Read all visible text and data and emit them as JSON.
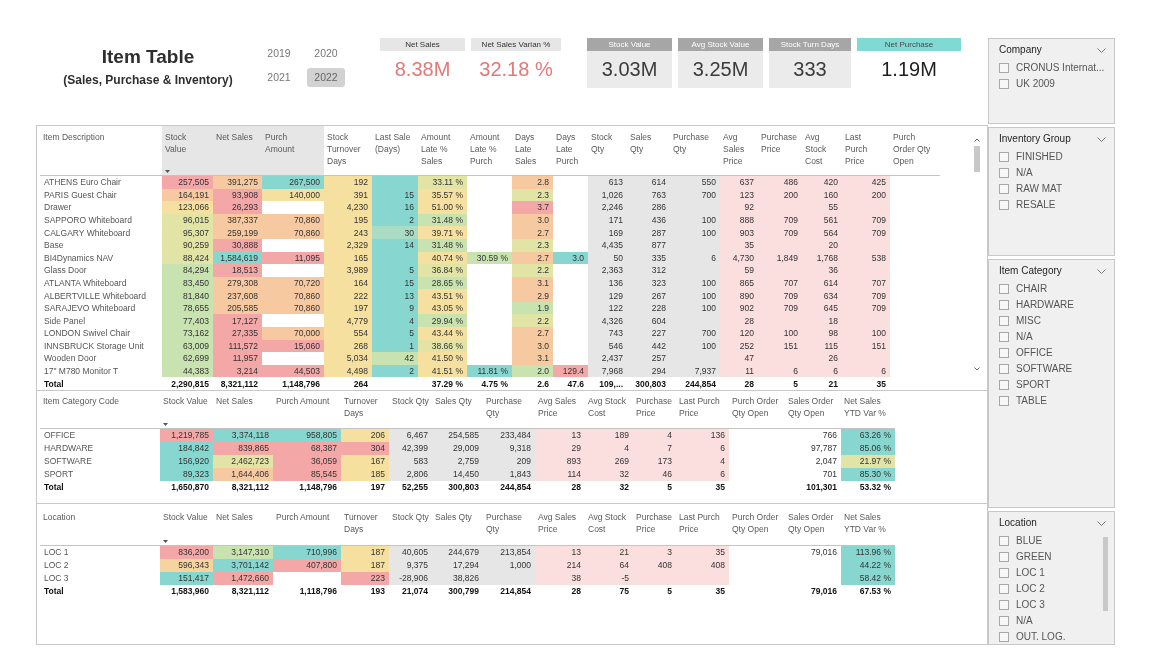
{
  "header": {
    "title": "Item Table",
    "subtitle": "(Sales, Purchase & Inventory)"
  },
  "years": [
    {
      "label": "2019",
      "selected": false
    },
    {
      "label": "2020",
      "selected": false
    },
    {
      "label": "2021",
      "selected": false
    },
    {
      "label": "2022",
      "selected": true
    }
  ],
  "cards": [
    {
      "kind": "sales",
      "label": "Net Sales",
      "value": "8.38M"
    },
    {
      "kind": "sales",
      "label": "Net Sales Varian %",
      "value": "32.18 %"
    },
    {
      "kind": "stock",
      "label": "Stock Value",
      "value": "3.03M"
    },
    {
      "kind": "stock",
      "label": "Avg Stock Value",
      "value": "3.25M"
    },
    {
      "kind": "stock",
      "label": "Stock Turn Days",
      "value": "333"
    },
    {
      "kind": "purchase",
      "label": "Net Purchase",
      "value": "1.19M"
    }
  ],
  "item_table": {
    "scrollable": true,
    "columns": [
      {
        "label": "Item Description",
        "sorted": false,
        "highlighted": false
      },
      {
        "label": "Stock Value",
        "sorted": true,
        "highlighted": true
      },
      {
        "label": "Net Sales",
        "sorted": false,
        "highlighted": true
      },
      {
        "label": "Purch Amount",
        "sorted": false,
        "highlighted": true
      },
      {
        "label": "Stock Turnover Days",
        "sorted": false,
        "highlighted": false
      },
      {
        "label": "Last Sale (Days)",
        "sorted": false,
        "highlighted": false
      },
      {
        "label": "Amount Late % Sales",
        "sorted": false,
        "highlighted": false
      },
      {
        "label": "Amount Late % Purch",
        "sorted": false,
        "highlighted": false
      },
      {
        "label": "Days Late Sales",
        "sorted": false,
        "highlighted": false
      },
      {
        "label": "Days Late Purch",
        "sorted": false,
        "highlighted": false
      },
      {
        "label": "Stock Qty",
        "sorted": false,
        "highlighted": false,
        "color": "#e6e6e6"
      },
      {
        "label": "Sales Qty",
        "sorted": false,
        "highlighted": false,
        "color": "#e6e6e6"
      },
      {
        "label": "Purchase Qty",
        "sorted": false,
        "highlighted": false,
        "color": "#e6e6e6"
      },
      {
        "label": "Avg Sales Price",
        "sorted": false,
        "highlighted": false,
        "color": "#fbdede"
      },
      {
        "label": "Purchase Price",
        "sorted": false,
        "highlighted": false,
        "color": "#fbdede"
      },
      {
        "label": "Avg Stock Cost",
        "sorted": false,
        "highlighted": false,
        "color": "#fbdede"
      },
      {
        "label": "Last Purch Price",
        "sorted": false,
        "highlighted": false,
        "color": "#fbdede"
      },
      {
        "label": "Purch Order Qty Open",
        "sorted": false,
        "highlighted": false
      }
    ],
    "rows": [
      [
        "ATHENS Euro Chair",
        {
          "text": "257,505",
          "color": "#f4a7a7"
        },
        {
          "text": "391,275",
          "color": "#f7c9a1"
        },
        {
          "text": "267,500",
          "color": "#87d7d0"
        },
        {
          "text": "192",
          "color": "#f6e09f"
        },
        {
          "color": "#87d7d0"
        },
        {
          "text": "33.11 %",
          "color": "#e1e4a5"
        },
        null,
        {
          "text": "2.8",
          "color": "#f7c9a1"
        },
        null,
        "613",
        "614",
        "550",
        "637",
        "486",
        "420",
        "425"
      ],
      [
        "PARIS Guest Chair",
        {
          "text": "164,191",
          "color": "#f7c9a1"
        },
        {
          "text": "93,908",
          "color": "#f4a7a7"
        },
        {
          "text": "140,000",
          "color": "#f6e09f"
        },
        {
          "text": "391",
          "color": "#f6e09f"
        },
        {
          "text": "15",
          "color": "#87d7d0"
        },
        {
          "text": "35.57 %",
          "color": "#f6e09f"
        },
        null,
        {
          "text": "2.3",
          "color": "#e1e4a5"
        },
        null,
        "1,026",
        "763",
        "700",
        "123",
        "200",
        "160",
        "200"
      ],
      [
        "Drawer",
        {
          "text": "123,066",
          "color": "#f6e09f"
        },
        {
          "text": "26,293",
          "color": "#f4a7a7"
        },
        null,
        {
          "text": "4,230",
          "color": "#f6e09f"
        },
        {
          "text": "16",
          "color": "#87d7d0"
        },
        {
          "text": "51.00 %",
          "color": "#f6e09f"
        },
        null,
        {
          "text": "3.7",
          "color": "#f4a7a7"
        },
        null,
        "2,246",
        "286",
        null,
        "92",
        null,
        "55",
        null
      ],
      [
        "SAPPORO Whiteboard",
        {
          "text": "96,015",
          "color": "#e1e4a5"
        },
        {
          "text": "387,337",
          "color": "#f7c9a1"
        },
        {
          "text": "70,860",
          "color": "#f7c9a1"
        },
        {
          "text": "195",
          "color": "#f6e09f"
        },
        {
          "text": "2",
          "color": "#87d7d0"
        },
        {
          "text": "31.48 %",
          "color": "#c8e2b0"
        },
        null,
        {
          "text": "3.0",
          "color": "#f7c9a1"
        },
        null,
        "171",
        "436",
        "100",
        "888",
        "709",
        "561",
        "709"
      ],
      [
        "CALGARY Whiteboard",
        {
          "text": "95,307",
          "color": "#e1e4a5"
        },
        {
          "text": "259,199",
          "color": "#f7c9a1"
        },
        {
          "text": "70,860",
          "color": "#f7c9a1"
        },
        {
          "text": "243",
          "color": "#f6e09f"
        },
        {
          "text": "30",
          "color": "#a9dcc3"
        },
        {
          "text": "39.71 %",
          "color": "#f6e09f"
        },
        null,
        {
          "text": "2.7",
          "color": "#f7c9a1"
        },
        null,
        "169",
        "287",
        "100",
        "903",
        "709",
        "564",
        "709"
      ],
      [
        "Base",
        {
          "text": "90,259",
          "color": "#e1e4a5"
        },
        {
          "text": "30,888",
          "color": "#f4a7a7"
        },
        null,
        {
          "text": "2,329",
          "color": "#f6e09f"
        },
        {
          "text": "14",
          "color": "#87d7d0"
        },
        {
          "text": "31.48 %",
          "color": "#c8e2b0"
        },
        null,
        {
          "text": "2.3",
          "color": "#e1e4a5"
        },
        null,
        "4,435",
        "877",
        null,
        "35",
        null,
        "20",
        null
      ],
      [
        "BI4Dynamics NAV",
        {
          "text": "88,424",
          "color": "#e1e4a5"
        },
        {
          "text": "1,584,619",
          "color": "#87d7d0"
        },
        {
          "text": "11,095",
          "color": "#f4a7a7"
        },
        {
          "text": "165",
          "color": "#f6e09f"
        },
        {
          "color": "#87d7d0"
        },
        {
          "text": "40.74 %",
          "color": "#f6e09f"
        },
        {
          "text": "30.59 %",
          "color": "#c8e2b0"
        },
        {
          "text": "2.7",
          "color": "#f7c9a1"
        },
        {
          "text": "3.0",
          "color": "#87d7d0"
        },
        "50",
        "335",
        "6",
        "4,730",
        "1,849",
        "1,768",
        "538"
      ],
      [
        "Glass Door",
        {
          "text": "84,294",
          "color": "#c8e2b0"
        },
        {
          "text": "18,513",
          "color": "#f4a7a7"
        },
        null,
        {
          "text": "3,989",
          "color": "#f6e09f"
        },
        {
          "text": "5",
          "color": "#87d7d0"
        },
        {
          "text": "36.84 %",
          "color": "#e1e4a5"
        },
        null,
        {
          "text": "2.2",
          "color": "#e1e4a5"
        },
        null,
        "2,363",
        "312",
        null,
        "59",
        null,
        "36",
        null
      ],
      [
        "ATLANTA Whiteboard",
        {
          "text": "83,450",
          "color": "#c8e2b0"
        },
        {
          "text": "279,308",
          "color": "#f7c9a1"
        },
        {
          "text": "70,720",
          "color": "#f7c9a1"
        },
        {
          "text": "164",
          "color": "#f6e09f"
        },
        {
          "text": "15",
          "color": "#87d7d0"
        },
        {
          "text": "28.65 %",
          "color": "#c8e2b0"
        },
        null,
        {
          "text": "3.1",
          "color": "#f7c9a1"
        },
        null,
        "136",
        "323",
        "100",
        "865",
        "707",
        "614",
        "707"
      ],
      [
        "ALBERTVILLE Whiteboard",
        {
          "text": "81,840",
          "color": "#c8e2b0"
        },
        {
          "text": "237,608",
          "color": "#f7c9a1"
        },
        {
          "text": "70,860",
          "color": "#f7c9a1"
        },
        {
          "text": "222",
          "color": "#f6e09f"
        },
        {
          "text": "13",
          "color": "#87d7d0"
        },
        {
          "text": "43.51 %",
          "color": "#f6e09f"
        },
        null,
        {
          "text": "2.9",
          "color": "#f7c9a1"
        },
        null,
        "129",
        "267",
        "100",
        "890",
        "709",
        "634",
        "709"
      ],
      [
        "SARAJEVO Whiteboard",
        {
          "text": "78,655",
          "color": "#c8e2b0"
        },
        {
          "text": "205,585",
          "color": "#f7c9a1"
        },
        {
          "text": "70,860",
          "color": "#f7c9a1"
        },
        {
          "text": "197",
          "color": "#f6e09f"
        },
        {
          "text": "9",
          "color": "#87d7d0"
        },
        {
          "text": "43.05 %",
          "color": "#f6e09f"
        },
        null,
        {
          "text": "1.9",
          "color": "#c8e2b0"
        },
        null,
        "122",
        "228",
        "100",
        "902",
        "709",
        "645",
        "709"
      ],
      [
        "Side Panel",
        {
          "text": "77,403",
          "color": "#c8e2b0"
        },
        {
          "text": "17,127",
          "color": "#f4a7a7"
        },
        null,
        {
          "text": "4,779",
          "color": "#f6e09f"
        },
        {
          "text": "4",
          "color": "#87d7d0"
        },
        {
          "text": "29.94 %",
          "color": "#c8e2b0"
        },
        null,
        {
          "text": "2.2",
          "color": "#e1e4a5"
        },
        null,
        "4,326",
        "604",
        null,
        "28",
        null,
        "18",
        null
      ],
      [
        "LONDON Swivel Chair",
        {
          "text": "73,162",
          "color": "#c8e2b0"
        },
        {
          "text": "27,335",
          "color": "#f4a7a7"
        },
        {
          "text": "70,000",
          "color": "#f7c9a1"
        },
        {
          "text": "554",
          "color": "#f6e09f"
        },
        {
          "text": "5",
          "color": "#87d7d0"
        },
        {
          "text": "43.44 %",
          "color": "#f6e09f"
        },
        null,
        {
          "text": "2.7",
          "color": "#f7c9a1"
        },
        null,
        "743",
        "227",
        "700",
        "120",
        "100",
        "98",
        "100"
      ],
      [
        "INNSBRUCK Storage Unit",
        {
          "text": "63,009",
          "color": "#c8e2b0"
        },
        {
          "text": "111,572",
          "color": "#f4a7a7"
        },
        {
          "text": "15,060",
          "color": "#f4a7a7"
        },
        {
          "text": "268",
          "color": "#f6e09f"
        },
        {
          "text": "1",
          "color": "#87d7d0"
        },
        {
          "text": "38.66 %",
          "color": "#e1e4a5"
        },
        null,
        {
          "text": "3.0",
          "color": "#f7c9a1"
        },
        null,
        "546",
        "442",
        "100",
        "252",
        "151",
        "115",
        "151"
      ],
      [
        "Wooden Door",
        {
          "text": "62,699",
          "color": "#c8e2b0"
        },
        {
          "text": "11,957",
          "color": "#f4a7a7"
        },
        null,
        {
          "text": "5,034",
          "color": "#f6e09f"
        },
        {
          "text": "42",
          "color": "#c8e2b0"
        },
        {
          "text": "41.50 %",
          "color": "#f6e09f"
        },
        null,
        {
          "text": "3.1",
          "color": "#f7c9a1"
        },
        null,
        "2,437",
        "257",
        null,
        "47",
        null,
        "26",
        null
      ],
      [
        "17\" M780 Monitor T",
        {
          "text": "44,383",
          "color": "#c8e2b0"
        },
        {
          "text": "3,214",
          "color": "#f4a7a7"
        },
        {
          "text": "44,503",
          "color": "#f4a7a7"
        },
        {
          "text": "4,498",
          "color": "#f6e09f"
        },
        {
          "text": "2",
          "color": "#87d7d0"
        },
        {
          "text": "41.51 %",
          "color": "#f6e09f"
        },
        {
          "text": "11.81 %",
          "color": "#87d7d0"
        },
        {
          "text": "2.0",
          "color": "#c8e2b0"
        },
        {
          "text": "129.4",
          "color": "#f4a7a7"
        },
        "7,968",
        "294",
        "7,937",
        "11",
        "6",
        "6",
        "6"
      ],
      [
        "Total",
        "2,290,815",
        "8,321,112",
        "1,148,796",
        "264",
        null,
        "37.29 %",
        "4.75 %",
        "2.6",
        "47.6",
        "109,...",
        "300,803",
        "244,854",
        "28",
        "5",
        "21",
        "35"
      ]
    ]
  },
  "category_table": {
    "columns": [
      {
        "label": "Item Category Code",
        "sorted": false
      },
      {
        "label": "Stock Value",
        "sorted": true
      },
      {
        "label": "Net Sales",
        "sorted": false
      },
      {
        "label": "Purch Amount",
        "sorted": false
      },
      {
        "label": "Turnover Days",
        "sorted": false
      },
      {
        "label": "Stock Qty",
        "sorted": false,
        "color": "#e6e6e6"
      },
      {
        "label": "Sales Qty",
        "sorted": false,
        "color": "#e6e6e6"
      },
      {
        "label": "Purchase Qty",
        "sorted": false,
        "color": "#e6e6e6"
      },
      {
        "label": "Avg Sales Price",
        "sorted": false,
        "color": "#fbdede"
      },
      {
        "label": "Avg Stock Cost",
        "sorted": false,
        "color": "#fbdede"
      },
      {
        "label": "Purchase Price",
        "sorted": false,
        "color": "#fbdede"
      },
      {
        "label": "Last Purch Price",
        "sorted": false,
        "color": "#fbdede"
      },
      {
        "label": "Purch Order Qty Open",
        "sorted": false
      },
      {
        "label": "Sales Order Qty Open",
        "sorted": false
      },
      {
        "label": "Net Sales YTD Var %",
        "sorted": false
      }
    ],
    "rows": [
      [
        "OFFICE",
        {
          "text": "1,219,785",
          "color": "#f4a7a7"
        },
        {
          "text": "3,374,118",
          "color": "#87d7d0"
        },
        {
          "text": "958,805",
          "color": "#87d7d0"
        },
        {
          "text": "206",
          "color": "#f6e09f"
        },
        "6,467",
        "254,585",
        "233,484",
        "13",
        "189",
        "4",
        "136",
        null,
        "766",
        {
          "text": "63.26 %",
          "color": "#87d7d0"
        }
      ],
      [
        "HARDWARE",
        {
          "text": "184,842",
          "color": "#87d7d0"
        },
        {
          "text": "839,865",
          "color": "#f4a7a7"
        },
        {
          "text": "68,387",
          "color": "#f4a7a7"
        },
        {
          "text": "304",
          "color": "#f4a7a7"
        },
        "42,399",
        "29,009",
        "9,318",
        "29",
        "4",
        "7",
        "6",
        null,
        "97,787",
        {
          "text": "85.06 %",
          "color": "#87d7d0"
        }
      ],
      [
        "SOFTWARE",
        {
          "text": "156,920",
          "color": "#87d7d0"
        },
        {
          "text": "2,462,723",
          "color": "#e1e4a5"
        },
        {
          "text": "36,059",
          "color": "#f4a7a7"
        },
        {
          "text": "167",
          "color": "#f6e09f"
        },
        "583",
        "2,759",
        "209",
        "893",
        "269",
        "173",
        "4",
        null,
        "2,047",
        {
          "text": "21.97 %",
          "color": "#e1e4a5"
        }
      ],
      [
        "SPORT",
        {
          "text": "89,323",
          "color": "#87d7d0"
        },
        {
          "text": "1,644,406",
          "color": "#f7c9a1"
        },
        {
          "text": "85,545",
          "color": "#f4a7a7"
        },
        {
          "text": "185",
          "color": "#f6e09f"
        },
        "2,806",
        "14,450",
        "1,843",
        "114",
        "32",
        "46",
        "6",
        null,
        "701",
        {
          "text": "85.30 %",
          "color": "#87d7d0"
        }
      ],
      [
        "Total",
        "1,650,870",
        "8,321,112",
        "1,148,796",
        "197",
        "52,255",
        "300,803",
        "244,854",
        "28",
        "32",
        "5",
        "35",
        null,
        "101,301",
        "53.32 %"
      ]
    ]
  },
  "location_table": {
    "columns": [
      {
        "label": "Location",
        "sorted": false
      },
      {
        "label": "Stock Value",
        "sorted": true
      },
      {
        "label": "Net Sales",
        "sorted": false
      },
      {
        "label": "Purch Amount",
        "sorted": false
      },
      {
        "label": "Turnover Days",
        "sorted": false
      },
      {
        "label": "Stock Qty",
        "sorted": false,
        "color": "#e6e6e6"
      },
      {
        "label": "Sales Qty",
        "sorted": false,
        "color": "#e6e6e6"
      },
      {
        "label": "Purchase Qty",
        "sorted": false,
        "color": "#e6e6e6"
      },
      {
        "label": "Avg Sales Price",
        "sorted": false,
        "color": "#fbdede"
      },
      {
        "label": "Avg Stock Cost",
        "sorted": false,
        "color": "#fbdede"
      },
      {
        "label": "Purchase Price",
        "sorted": false,
        "color": "#fbdede"
      },
      {
        "label": "Last Purch Price",
        "sorted": false,
        "color": "#fbdede"
      },
      {
        "label": "Purch Order Qty Open",
        "sorted": false
      },
      {
        "label": "Sales Order Qty Open",
        "sorted": false
      },
      {
        "label": "Net Sales YTD Var %",
        "sorted": false
      }
    ],
    "rows": [
      [
        "LOC 1",
        {
          "text": "836,200",
          "color": "#f4a7a7"
        },
        {
          "text": "3,147,310",
          "color": "#c8e2b0"
        },
        {
          "text": "710,996",
          "color": "#87d7d0"
        },
        {
          "text": "187",
          "color": "#f6e09f"
        },
        "40,605",
        "244,679",
        "213,854",
        "13",
        "21",
        "3",
        "35",
        null,
        "79,016",
        {
          "text": "113.96 %",
          "color": "#87d7d0"
        }
      ],
      [
        "LOC 2",
        {
          "text": "596,343",
          "color": "#f7d3a0"
        },
        {
          "text": "3,701,142",
          "color": "#87d7d0"
        },
        {
          "text": "407,800",
          "color": "#f4a7a7"
        },
        {
          "text": "187",
          "color": "#f6e09f"
        },
        "9,375",
        "17,294",
        "1,000",
        "214",
        "64",
        "408",
        "408",
        null,
        null,
        {
          "text": "44.22 %",
          "color": "#87d7d0"
        }
      ],
      [
        "LOC 3",
        {
          "text": "151,417",
          "color": "#87d7d0"
        },
        {
          "text": "1,472,660",
          "color": "#f4a7a7"
        },
        null,
        {
          "text": "223",
          "color": "#f4a7a7"
        },
        "-28,906",
        "38,826",
        null,
        "38",
        "-5",
        null,
        null,
        null,
        null,
        {
          "text": "58.42 %",
          "color": "#87d7d0"
        }
      ],
      [
        "Total",
        "1,583,960",
        "8,321,112",
        "1,118,796",
        "193",
        "21,074",
        "300,799",
        "214,854",
        "28",
        "75",
        "5",
        "35",
        null,
        "79,016",
        "67.53 %"
      ]
    ]
  },
  "slicers": [
    {
      "title": "Company",
      "scrollable": false,
      "items": [
        {
          "label": "CRONUS Internat...",
          "checked": false
        },
        {
          "label": "UK 2009",
          "checked": false
        }
      ]
    },
    {
      "title": "Inventory Group",
      "scrollable": false,
      "items": [
        {
          "label": "FINISHED",
          "checked": false
        },
        {
          "label": "N/A",
          "checked": false
        },
        {
          "label": "RAW MAT",
          "checked": false
        },
        {
          "label": "RESALE",
          "checked": false
        }
      ]
    },
    {
      "title": "Item Category",
      "scrollable": false,
      "items": [
        {
          "label": "CHAIR",
          "checked": false
        },
        {
          "label": "HARDWARE",
          "checked": false
        },
        {
          "label": "MISC",
          "checked": false
        },
        {
          "label": "N/A",
          "checked": false
        },
        {
          "label": "OFFICE",
          "checked": false
        },
        {
          "label": "SOFTWARE",
          "checked": false
        },
        {
          "label": "SPORT",
          "checked": false
        },
        {
          "label": "TABLE",
          "checked": false
        }
      ]
    },
    {
      "title": "Location",
      "scrollable": true,
      "items": [
        {
          "label": "BLUE",
          "checked": false
        },
        {
          "label": "GREEN",
          "checked": false
        },
        {
          "label": "LOC 1",
          "checked": false
        },
        {
          "label": "LOC 2",
          "checked": false
        },
        {
          "label": "LOC 3",
          "checked": false
        },
        {
          "label": "N/A",
          "checked": false
        },
        {
          "label": "OUT. LOG.",
          "checked": false
        }
      ]
    }
  ]
}
